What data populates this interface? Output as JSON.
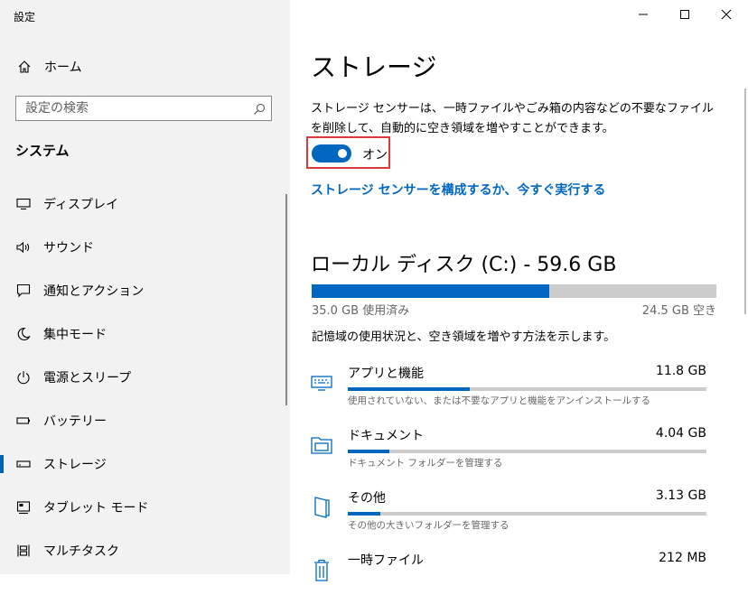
{
  "window": {
    "title": "設定",
    "controls": [
      "minimize-icon",
      "maximize-icon",
      "close-icon"
    ]
  },
  "sidebar": {
    "home_label": "ホーム",
    "search_placeholder": "設定の検索",
    "section_title": "システム",
    "items": [
      {
        "label": "ディスプレイ",
        "icon": "display-icon",
        "selected": false
      },
      {
        "label": "サウンド",
        "icon": "sound-icon",
        "selected": false
      },
      {
        "label": "通知とアクション",
        "icon": "notification-icon",
        "selected": false
      },
      {
        "label": "集中モード",
        "icon": "focus-moon-icon",
        "selected": false
      },
      {
        "label": "電源とスリープ",
        "icon": "power-icon",
        "selected": false
      },
      {
        "label": "バッテリー",
        "icon": "battery-icon",
        "selected": false
      },
      {
        "label": "ストレージ",
        "icon": "storage-icon",
        "selected": true
      },
      {
        "label": "タブレット モード",
        "icon": "tablet-icon",
        "selected": false
      },
      {
        "label": "マルチタスク",
        "icon": "multitask-icon",
        "selected": false
      }
    ]
  },
  "main": {
    "title": "ストレージ",
    "description": "ストレージ センサーは、一時ファイルやごみ箱の内容などの不要なファイルを削除して、自動的に空き領域を増やすことができます。",
    "toggle": {
      "state_label": "オン",
      "on": true
    },
    "configure_link": "ストレージ センサーを構成するか、今すぐ実行する",
    "disk": {
      "title": "ローカル ディスク (C:) - 59.6 GB",
      "used_label": "35.0 GB 使用済み",
      "free_label": "24.5 GB 空き",
      "used_fraction": 0.588
    },
    "explain": "記憶域の使用状況と、空き領域を増やす方法を示します。",
    "categories": [
      {
        "name": "アプリと機能",
        "size": "11.8 GB",
        "desc": "使用されていない、または不要なアプリと機能をアンインストールする",
        "fraction": 0.34,
        "icon": "keyboard-icon"
      },
      {
        "name": "ドキュメント",
        "size": "4.04 GB",
        "desc": "ドキュメント フォルダーを管理する",
        "fraction": 0.117,
        "icon": "folder-icon"
      },
      {
        "name": "その他",
        "size": "3.13 GB",
        "desc": "その他の大きいフォルダーを管理する",
        "fraction": 0.09,
        "icon": "other-files-icon"
      },
      {
        "name": "一時ファイル",
        "size": "212 MB",
        "desc": "",
        "fraction": 0.006,
        "icon": "trash-icon"
      }
    ]
  },
  "colors": {
    "accent": "#0067c0",
    "sidebar_bg": "#f2f2f2",
    "highlight_border": "#e03838"
  }
}
